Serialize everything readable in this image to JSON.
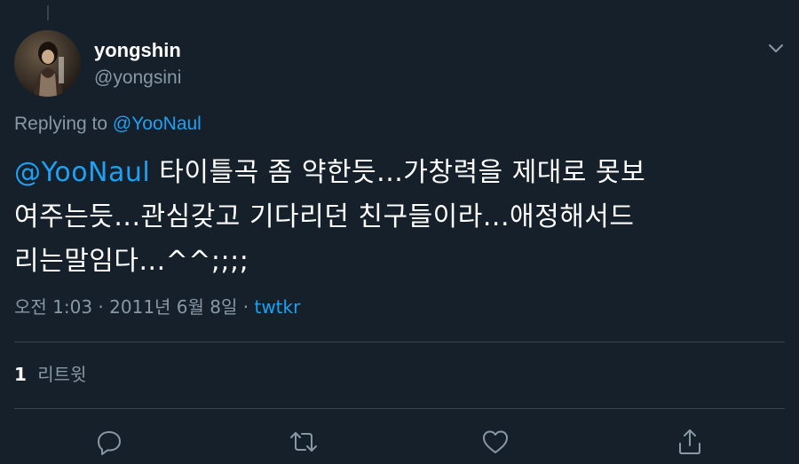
{
  "tweet": {
    "display_name": "yongshin",
    "handle": "@yongsini",
    "replying_prefix": "Replying to",
    "replying_to": "@YooNaul",
    "mention": "@YooNaul",
    "line1_rest": "타이틀곡 좀 약한듯...가창력을 제대로 못보",
    "line2": "여주는듯...관심갖고 기다리던 친구들이라...애정해서드",
    "line3": "리는말임다...^^;;;;",
    "timestamp": "오전 1:03 · 2011년 6월 8일 ·",
    "source": "twtkr",
    "retweet_count": "1",
    "retweet_label": "리트윗"
  },
  "icons": {
    "caret": "chevron-down-icon",
    "reply": "reply-icon",
    "retweet": "retweet-icon",
    "like": "heart-icon",
    "share": "share-icon"
  },
  "colors": {
    "background": "#15202b",
    "text": "#ffffff",
    "secondary": "#8899a6",
    "accent": "#1da1f2",
    "divider": "#38444d"
  }
}
